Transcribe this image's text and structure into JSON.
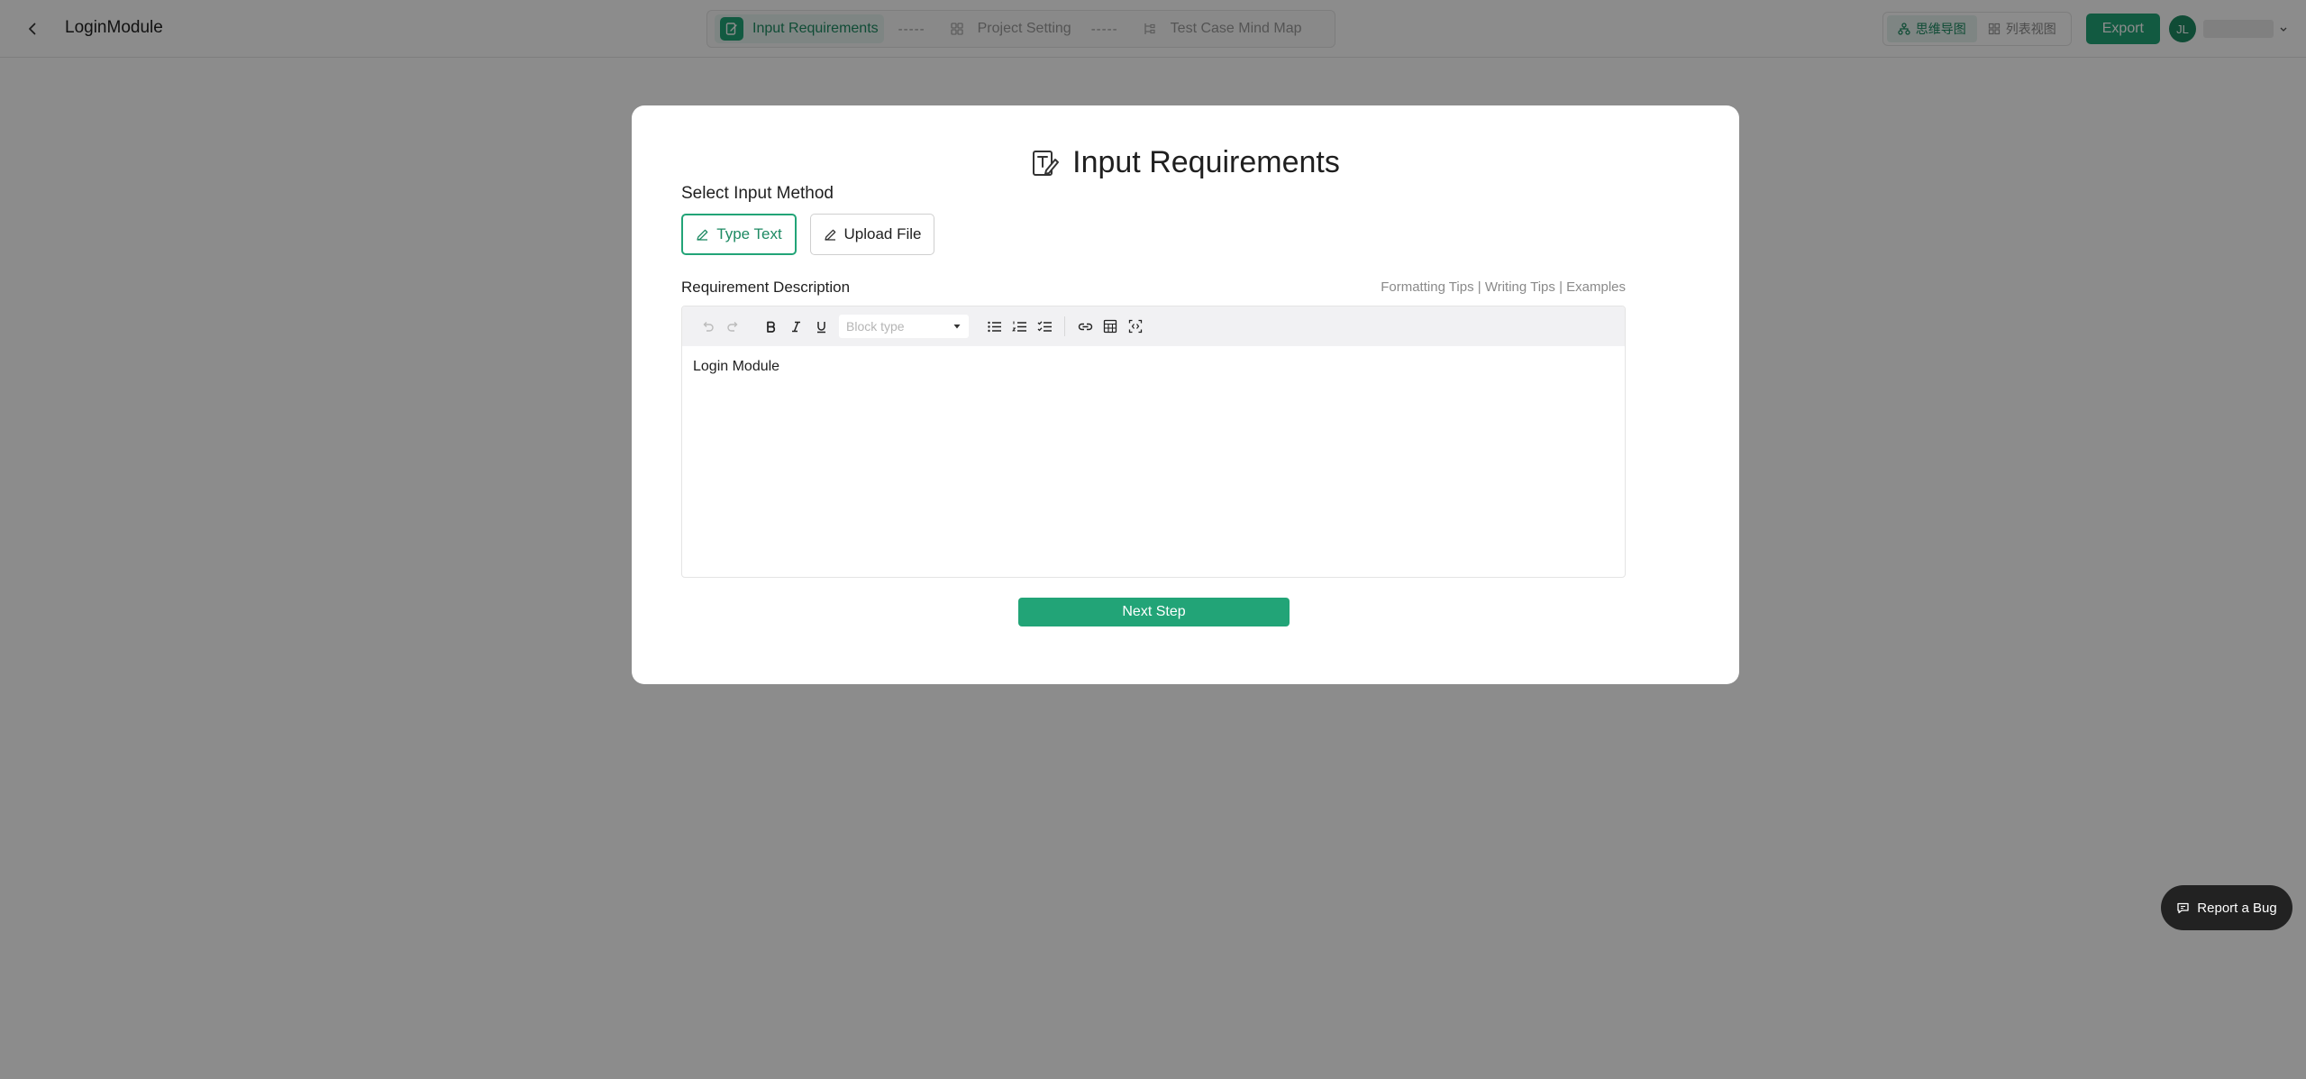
{
  "header": {
    "title": "LoginModule",
    "steps": [
      {
        "label": "Input Requirements",
        "active": true
      },
      {
        "label": "Project Setting",
        "active": false
      },
      {
        "label": "Test Case Mind Map",
        "active": false
      }
    ],
    "step_separator": "-----",
    "view_toggle": [
      {
        "label": "思维导图",
        "active": true
      },
      {
        "label": "列表视图",
        "active": false
      }
    ],
    "export_label": "Export",
    "avatar_initials": "JL"
  },
  "modal": {
    "title": "Input Requirements",
    "input_method_label": "Select Input Method",
    "methods": [
      {
        "label": "Type Text",
        "active": true
      },
      {
        "label": "Upload File",
        "active": false
      }
    ],
    "description_label": "Requirement Description",
    "tips": [
      "Formatting Tips",
      "Writing Tips",
      "Examples"
    ],
    "tips_separator": " | ",
    "block_type_placeholder": "Block type",
    "editor_content": "Login Module",
    "next_label": "Next Step"
  },
  "bug_report_label": "Report a Bug",
  "colors": {
    "accent": "#22a477",
    "accent_text": "#1e8a63",
    "overlay": "rgba(0,0,0,0.45)"
  }
}
